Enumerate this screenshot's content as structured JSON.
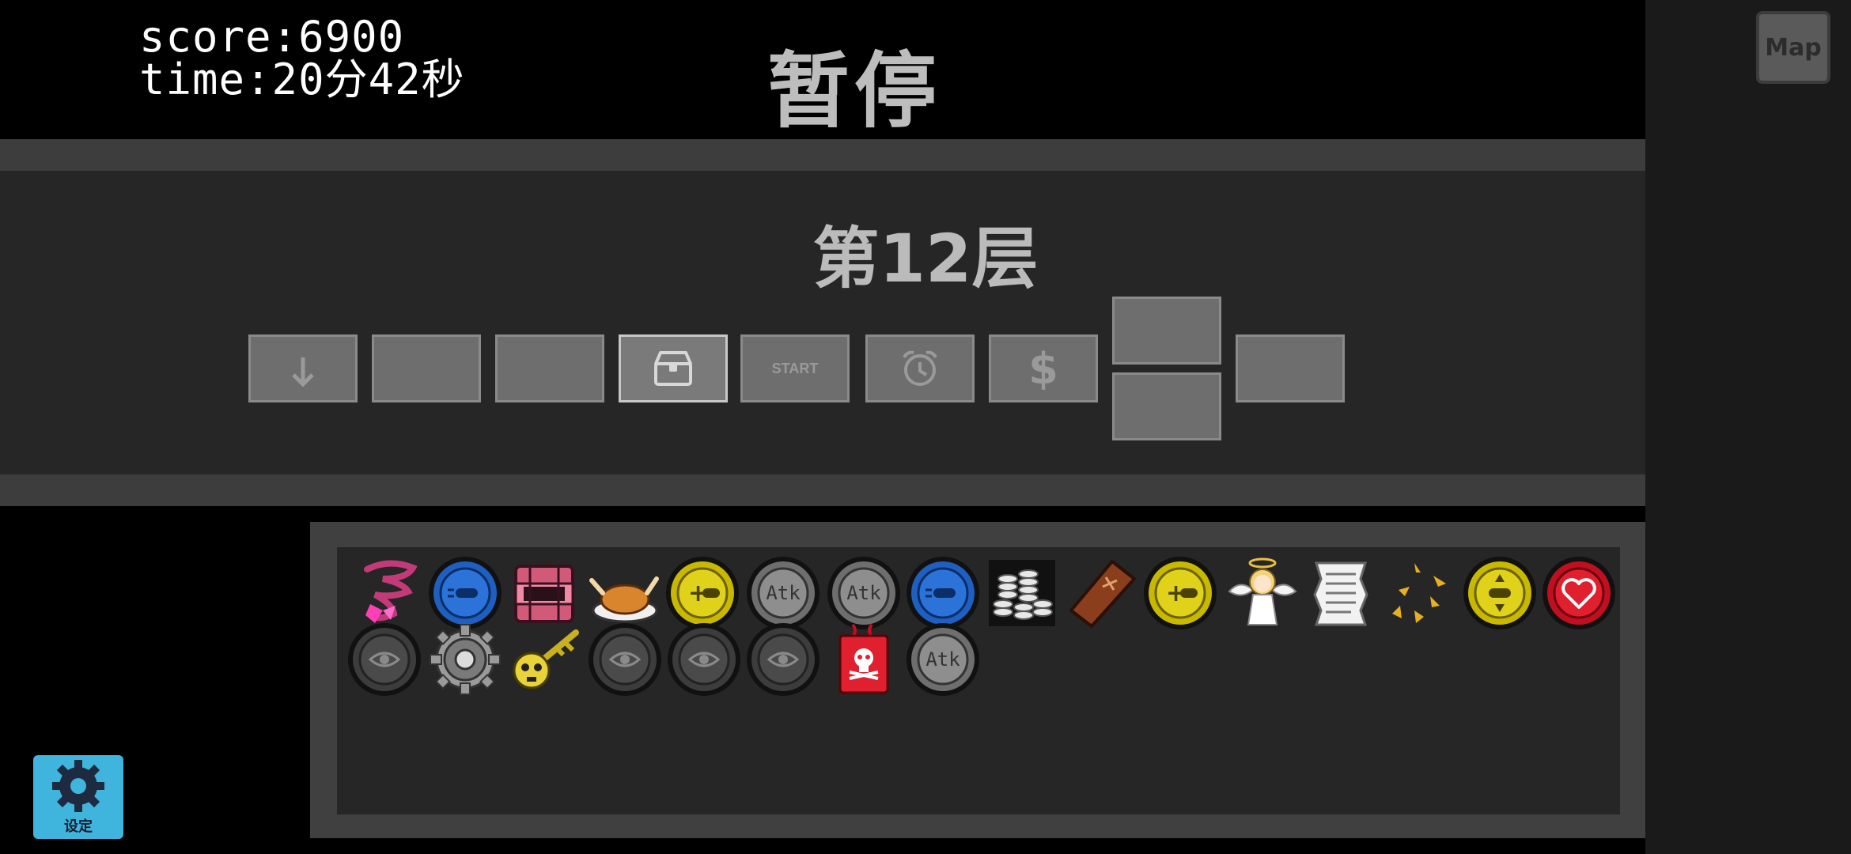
{
  "hud": {
    "score": "score:6900",
    "time": "time:20分42秒",
    "pause_title": "暂停",
    "map_label": "Map"
  },
  "floor": {
    "title": "第12层",
    "rooms": [
      {
        "icon": "down-arrow-icon",
        "label": ""
      },
      {
        "icon": "",
        "label": ""
      },
      {
        "icon": "",
        "label": ""
      },
      {
        "icon": "treasure-chest-icon",
        "label": "",
        "current": true
      },
      {
        "icon": "",
        "label": "START"
      },
      {
        "icon": "alarm-clock-icon",
        "label": ""
      },
      {
        "icon": "dollar-icon",
        "label": ""
      },
      {
        "icon": "",
        "label": ""
      },
      {
        "icon": "",
        "label": ""
      },
      {
        "icon": "",
        "label": ""
      }
    ]
  },
  "inventory": {
    "items": [
      {
        "name": "pink-butterfly-tornado",
        "kind": "tornado"
      },
      {
        "name": "blue-bullet-coin",
        "kind": "blue-coin"
      },
      {
        "name": "pink-chest",
        "kind": "chest"
      },
      {
        "name": "roast-chicken",
        "kind": "chicken"
      },
      {
        "name": "yellow-plus-bullet-coin",
        "kind": "yellow-coin",
        "text": "+"
      },
      {
        "name": "atk-coin",
        "kind": "atk-coin",
        "text": "Atk"
      },
      {
        "name": "atk-coin",
        "kind": "atk-coin",
        "text": "Atk"
      },
      {
        "name": "blue-bullet-coin",
        "kind": "blue-coin"
      },
      {
        "name": "coin-stacks",
        "kind": "stacks"
      },
      {
        "name": "coffin",
        "kind": "coffin"
      },
      {
        "name": "yellow-plus-bullet-coin",
        "kind": "yellow-coin",
        "text": "+"
      },
      {
        "name": "angel",
        "kind": "angel"
      },
      {
        "name": "scroll",
        "kind": "scroll"
      },
      {
        "name": "sparks",
        "kind": "sparks"
      },
      {
        "name": "yellow-arrows-coin",
        "kind": "yellow-arrows-coin"
      },
      {
        "name": "red-heart-coin",
        "kind": "heart-coin"
      },
      {
        "name": "eye-coin",
        "kind": "eye-coin"
      },
      {
        "name": "gear",
        "kind": "gear"
      },
      {
        "name": "skull-key",
        "kind": "key"
      },
      {
        "name": "eye-coin",
        "kind": "eye-coin"
      },
      {
        "name": "eye-coin",
        "kind": "eye-coin"
      },
      {
        "name": "eye-coin",
        "kind": "eye-coin"
      },
      {
        "name": "poison-bag",
        "kind": "poison"
      },
      {
        "name": "atk-coin",
        "kind": "atk-coin",
        "text": "Atk"
      }
    ]
  },
  "settings": {
    "label": "设定"
  },
  "colors": {
    "background": "#000000",
    "panel": "#262626",
    "band": "#3d3d3d",
    "settings_accent": "#3fb4dc"
  }
}
